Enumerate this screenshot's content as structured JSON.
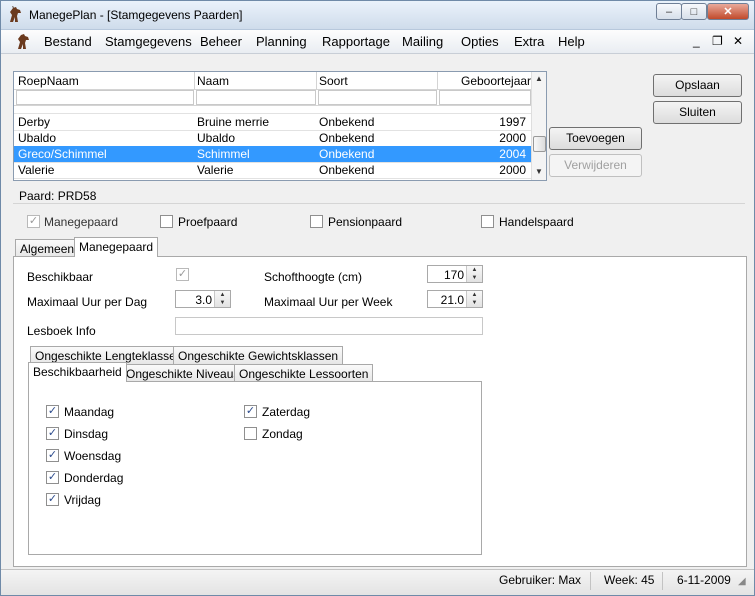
{
  "window": {
    "title": "ManegePlan - [Stamgegevens Paarden]",
    "controls": {
      "minimize": "–",
      "maximize": "□",
      "close": "✕"
    }
  },
  "menu": {
    "items": [
      "Bestand",
      "Stamgegevens",
      "Beheer",
      "Planning",
      "Rapportage",
      "Mailing",
      "Opties",
      "Extra",
      "Help"
    ],
    "mdi": {
      "minimize": "_",
      "restore": "❐",
      "close": "✕"
    }
  },
  "grid": {
    "columns": [
      "RoepNaam",
      "Naam",
      "Soort",
      "Geboortejaar"
    ],
    "rows": [
      {
        "roepnaam": "Derby",
        "naam": "Bruine merrie",
        "soort": "Onbekend",
        "jaar": "1997",
        "selected": false
      },
      {
        "roepnaam": "Ubaldo",
        "naam": "Ubaldo",
        "soort": "Onbekend",
        "jaar": "2000",
        "selected": false
      },
      {
        "roepnaam": "Greco/Schimmel",
        "naam": "Schimmel",
        "soort": "Onbekend",
        "jaar": "2004",
        "selected": true
      },
      {
        "roepnaam": "Valerie",
        "naam": "Valerie",
        "soort": "Onbekend",
        "jaar": "2000",
        "selected": false
      }
    ]
  },
  "buttons": {
    "opslaan": "Opslaan",
    "sluiten": "Sluiten",
    "toevoegen": "Toevoegen",
    "verwijderen": "Verwijderen"
  },
  "paard": {
    "label": "Paard: PRD58"
  },
  "types": [
    {
      "label": "Manegepaard",
      "checked": true,
      "disabled": true
    },
    {
      "label": "Proefpaard",
      "checked": false,
      "disabled": false
    },
    {
      "label": "Pensionpaard",
      "checked": false,
      "disabled": false
    },
    {
      "label": "Handelspaard",
      "checked": false,
      "disabled": false
    }
  ],
  "tabs": [
    "Algemeen",
    "Manegepaard"
  ],
  "manege": {
    "beschikbaar_label": "Beschikbaar",
    "max_uur_dag_label": "Maximaal Uur per Dag",
    "max_uur_dag": "3.0",
    "schofthoogte_label": "Schofthoogte (cm)",
    "schofthoogte": "170",
    "max_uur_week_label": "Maximaal Uur per Week",
    "max_uur_week": "21.0",
    "lesboek_label": "Lesboek Info",
    "lesboek_value": ""
  },
  "subtabs": {
    "row1": [
      "Ongeschikte Lengteklassen",
      "Ongeschikte Gewichtsklassen"
    ],
    "row2": [
      "Beschikbaarheid",
      "Ongeschikte Niveaus",
      "Ongeschikte Lessoorten"
    ]
  },
  "days": [
    {
      "label": "Maandag",
      "checked": true
    },
    {
      "label": "Dinsdag",
      "checked": true
    },
    {
      "label": "Woensdag",
      "checked": true
    },
    {
      "label": "Donderdag",
      "checked": true
    },
    {
      "label": "Vrijdag",
      "checked": true
    },
    {
      "label": "Zaterdag",
      "checked": true
    },
    {
      "label": "Zondag",
      "checked": false
    }
  ],
  "status": {
    "user": "Gebruiker: Max",
    "week": "Week: 45",
    "date": "6-11-2009"
  }
}
